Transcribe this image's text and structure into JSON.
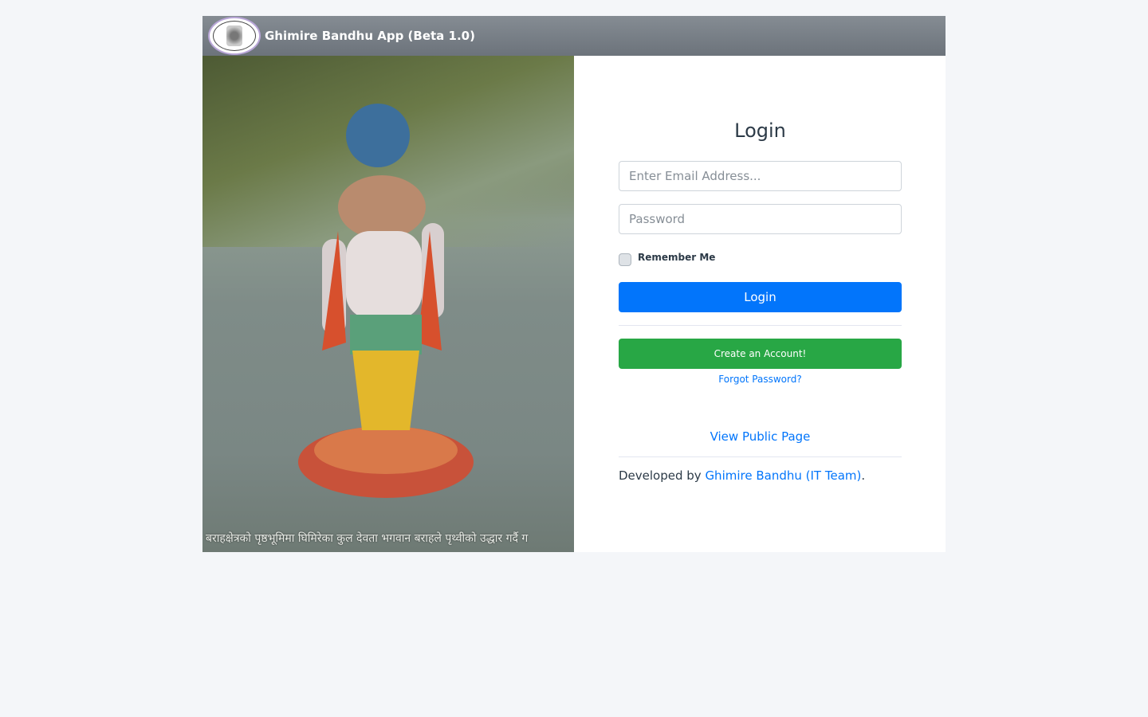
{
  "header": {
    "title": "Ghimire Bandhu App (Beta 1.0)",
    "logo": "organization-emblem"
  },
  "photo": {
    "caption": "बराहक्षेत्रको पृष्ठभूमिमा घिमिरेका कुल देवता भगवान बराहले पृथ्वीको उद्धार गर्दै ग"
  },
  "form": {
    "title": "Login",
    "email_placeholder": "Enter Email Address...",
    "email_value": "",
    "password_placeholder": "Password",
    "password_value": "",
    "remember_label": "Remember Me",
    "remember_checked": false,
    "login_label": "Login",
    "create_label": "Create an Account!",
    "forgot_label": "Forgot Password?",
    "public_label": "View Public Page",
    "dev_prefix": "Developed by ",
    "dev_link": "Ghimire Bandhu (IT Team)",
    "dev_suffix": "."
  },
  "colors": {
    "primary": "#0275fb",
    "success": "#28a745",
    "header": "#6c737b",
    "background": "#f4f6f9"
  }
}
